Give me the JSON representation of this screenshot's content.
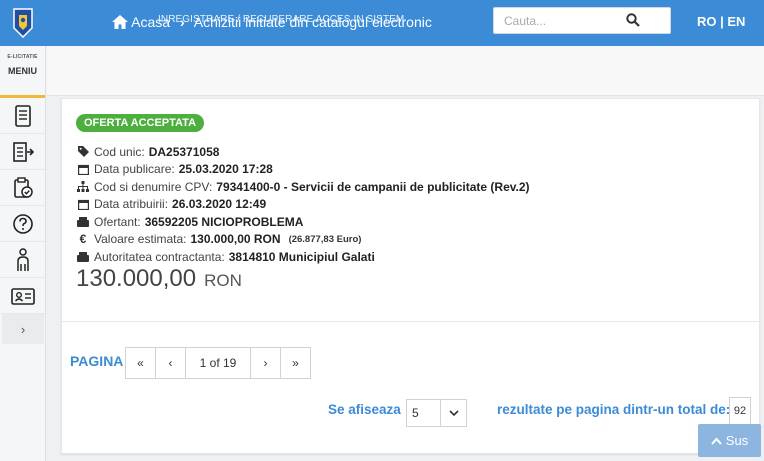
{
  "header": {
    "breadcrumb_home": "Acasa",
    "breadcrumb_current": "Achizitii initiate din catalogul electronic",
    "links_overlay": "INREGISTRARE / RECUPERARE  ACCES IN SISTEM",
    "search_placeholder": "Cauta...",
    "lang_ro": "RO",
    "lang_sep": "|",
    "lang_en": "EN"
  },
  "sidebar": {
    "brand_small": "E-LICITATIE",
    "menu_label": "MENIU",
    "items": [
      "document-icon",
      "list-export-icon",
      "clipboard-check-icon",
      "help-icon",
      "person-icon",
      "id-card-icon"
    ],
    "collapse": "›"
  },
  "offer": {
    "status": "OFERTA ACCEPTATA",
    "fields": [
      {
        "label": "Cod unic:",
        "value": "DA25371058"
      },
      {
        "label": "Data publicare:",
        "value": "25.03.2020 17:28"
      },
      {
        "label": "Cod si denumire CPV:",
        "value": "79341400-0 - Servicii de campanii de publicitate (Rev.2)"
      },
      {
        "label": "Data atribuirii:",
        "value": "26.03.2020 12:49"
      },
      {
        "label": "Ofertant:",
        "value": "36592205 NICIOPROBLEMA"
      },
      {
        "label": "Valoare estimata:",
        "value": "130.000,00  RON",
        "extra": "(26.877,83  Euro)"
      },
      {
        "label": "Autoritatea contractanta:",
        "value": "3814810 Municipiul Galati"
      }
    ],
    "price_amount": "130.000,00",
    "price_currency": "RON"
  },
  "pagination": {
    "label": "PAGINA",
    "first": "«",
    "prev": "‹",
    "current": "1 of 19",
    "next": "›",
    "last": "»",
    "results_prefix": "Se afiseaza",
    "page_size": "5",
    "results_suffix": "rezultate pe pagina dintr-un total de:",
    "total": "92"
  },
  "scroll_top": "Sus",
  "colors": {
    "primary": "#3b8bd6",
    "badge": "#4caf3e",
    "accent": "#f0b93a"
  }
}
